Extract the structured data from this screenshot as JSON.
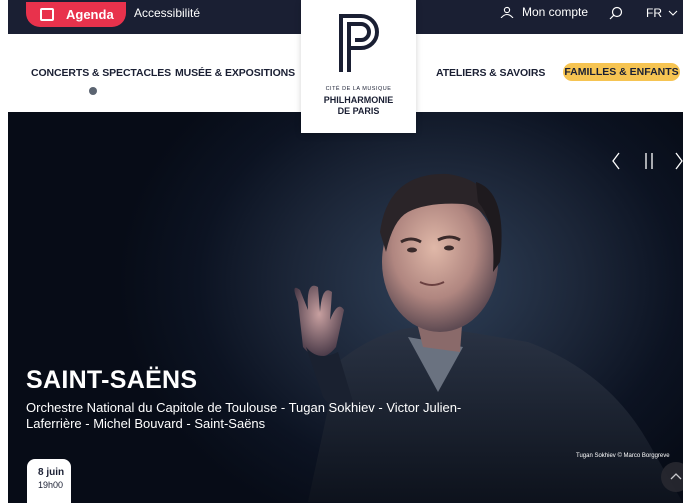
{
  "topbar": {
    "agenda_label": "Agenda",
    "accessibility_label": "Accessibilité",
    "account_label": "Mon compte",
    "language_label": "FR"
  },
  "nav": {
    "items": [
      {
        "label": "CONCERTS & SPECTACLES"
      },
      {
        "label": "MUSÉE & EXPOSITIONS"
      },
      {
        "label": "ATELIERS & SAVOIRS"
      },
      {
        "label": "FAMILLES & ENFANTS"
      }
    ]
  },
  "logo": {
    "small_text": "CITÉ DE LA MUSIQUE",
    "line1": "PHILHARMONIE",
    "line2": "DE PARIS"
  },
  "hero": {
    "title": "SAINT-SAËNS",
    "subtitle": "Orchestre National du Capitole de Toulouse - Tugan Sokhiev - Victor Julien-Laferrière - Michel Bouvard - Saint-Saëns",
    "photo_credit": "Tugan Sokhiev © Marco Borggreve",
    "date_day": "8 juin",
    "date_time": "19h00"
  },
  "colors": {
    "topbar_bg": "#1a1f33",
    "agenda_accent": "#e8324c",
    "familles_accent": "#f6c452"
  },
  "icons": [
    "calendar-icon",
    "user-icon",
    "search-icon",
    "chevron-down-icon",
    "previous-icon",
    "pause-icon",
    "next-icon",
    "scroll-up-icon"
  ]
}
